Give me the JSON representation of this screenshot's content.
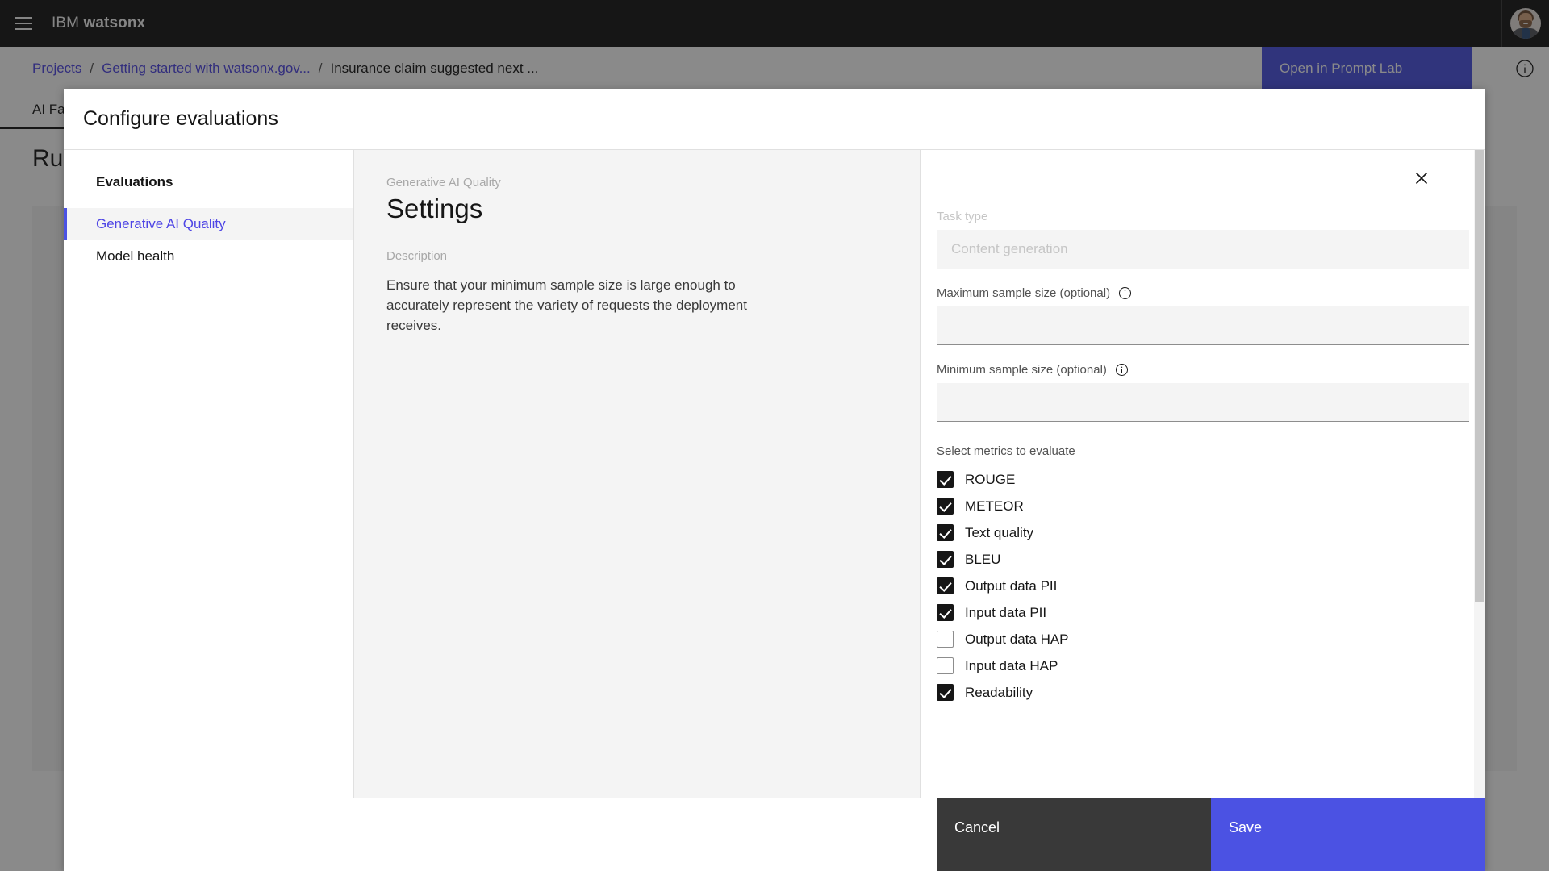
{
  "topnav": {
    "menu_icon": "hamburger-icon",
    "brand_light": "IBM",
    "brand_bold": "watsonx",
    "avatar_icon": "user-avatar"
  },
  "breadcrumb": {
    "items": [
      {
        "label": "Projects",
        "type": "link"
      },
      {
        "label": "Getting started with watsonx.gov...",
        "type": "link"
      },
      {
        "label": "Insurance claim suggested next ...",
        "type": "current"
      }
    ],
    "separator": "/",
    "open_prompt_lab": "Open in Prompt Lab",
    "info_icon": "information-icon"
  },
  "page": {
    "tab_label": "AI Factsheet",
    "heading": "Run"
  },
  "modal": {
    "title": "Configure evaluations",
    "close_icon": "close-icon",
    "sidenav": {
      "heading": "Evaluations",
      "items": [
        {
          "label": "Generative AI Quality",
          "active": true
        },
        {
          "label": "Model health",
          "active": false
        }
      ]
    },
    "center": {
      "eyebrow": "Generative AI Quality",
      "title": "Settings",
      "description_label": "Description",
      "description": "Ensure that your minimum sample size is large enough to accurately represent the variety of requests the deployment receives."
    },
    "form": {
      "task_type": {
        "label": "Task type",
        "value": "Content generation",
        "disabled": true
      },
      "max_sample_size": {
        "label": "Maximum sample size (optional)",
        "value": "",
        "info_icon": "information-icon"
      },
      "min_sample_size": {
        "label": "Minimum sample size (optional)",
        "value": "",
        "info_icon": "information-icon"
      },
      "metrics_label": "Select metrics to evaluate",
      "metrics": [
        {
          "label": "ROUGE",
          "checked": true
        },
        {
          "label": "METEOR",
          "checked": true
        },
        {
          "label": "Text quality",
          "checked": true
        },
        {
          "label": "BLEU",
          "checked": true
        },
        {
          "label": "Output data PII",
          "checked": true
        },
        {
          "label": "Input data PII",
          "checked": true
        },
        {
          "label": "Output data HAP",
          "checked": false
        },
        {
          "label": "Input data HAP",
          "checked": false
        },
        {
          "label": "Readability",
          "checked": true
        }
      ]
    },
    "footer": {
      "cancel_label": "Cancel",
      "save_label": "Save"
    }
  },
  "colors": {
    "brand_blue": "#4b52e3",
    "link_purple": "#4f46e5",
    "dark": "#161616",
    "cancel_gray": "#393939",
    "panel_gray": "#f4f4f4"
  }
}
